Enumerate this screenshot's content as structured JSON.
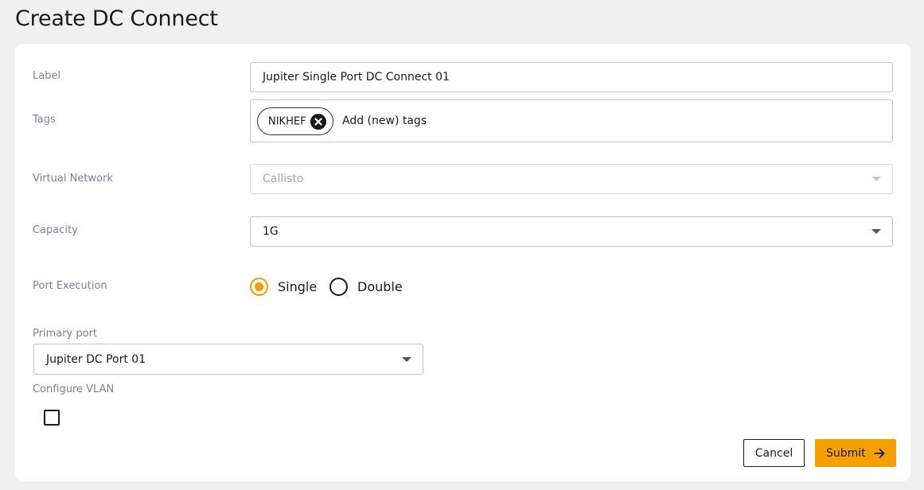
{
  "page": {
    "title": "Create DC Connect"
  },
  "form": {
    "label": {
      "caption": "Label",
      "value": "Jupiter Single Port DC Connect 01"
    },
    "tags": {
      "caption": "Tags",
      "chips": [
        {
          "text": "NIKHEF"
        }
      ],
      "placeholder": "Add (new) tags"
    },
    "virtual_network": {
      "caption": "Virtual Network",
      "value": "Callisto",
      "disabled": true
    },
    "capacity": {
      "caption": "Capacity",
      "value": "1G"
    },
    "port_execution": {
      "caption": "Port Execution",
      "options": [
        {
          "label": "Single",
          "selected": true
        },
        {
          "label": "Double",
          "selected": false
        }
      ]
    },
    "primary_port": {
      "caption": "Primary port",
      "value": "Jupiter DC Port 01"
    },
    "configure_vlan": {
      "caption": "Configure VLAN",
      "checked": false
    }
  },
  "actions": {
    "cancel_label": "Cancel",
    "submit_label": "Submit"
  },
  "colors": {
    "accent": "#f5a000",
    "label_text": "#7c7f96",
    "background": "#f0f0f0"
  },
  "icons": {
    "chip_remove": "close-circle-icon",
    "submit": "arrow-right-icon",
    "dropdown": "caret-down-icon"
  }
}
